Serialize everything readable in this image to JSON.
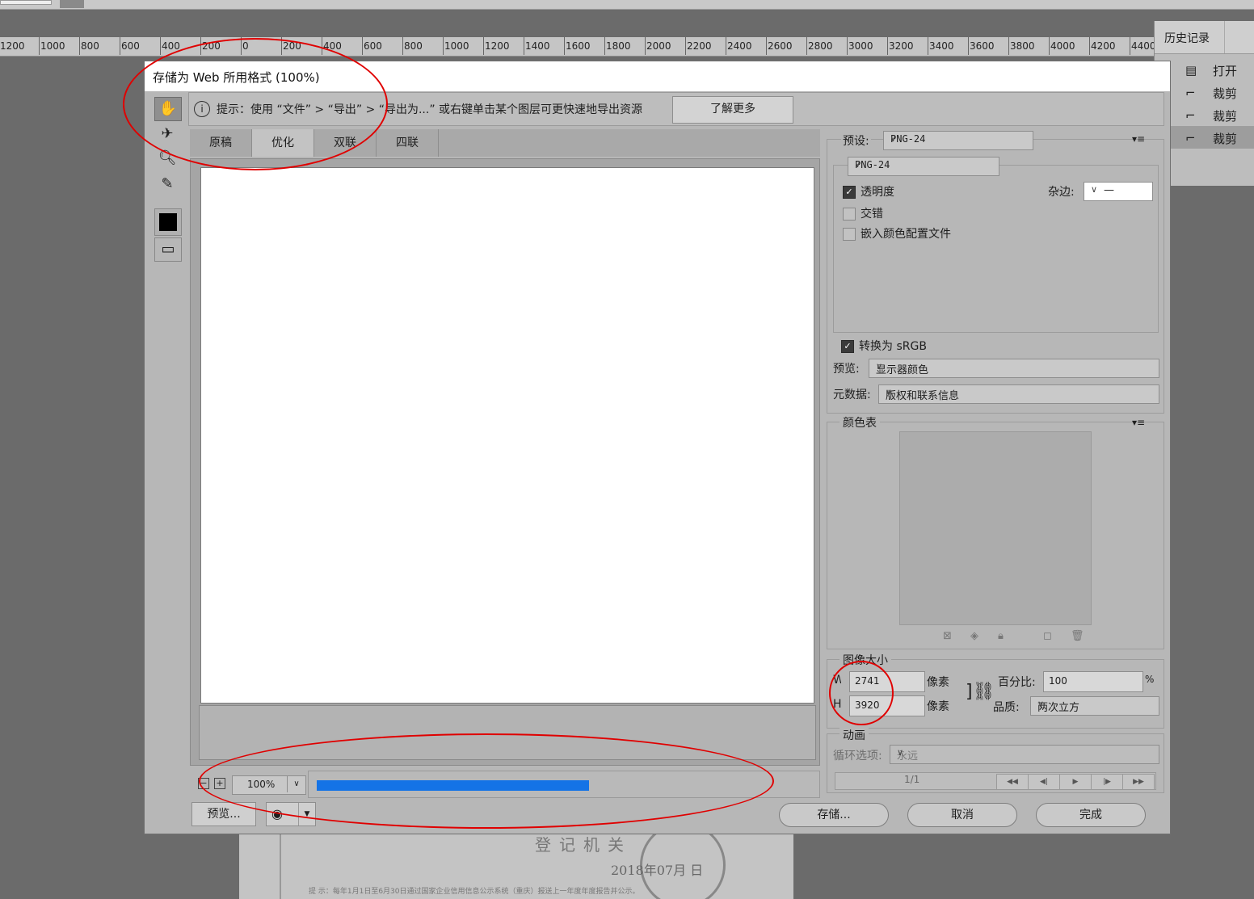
{
  "ruler": {
    "ticks": [
      "1200",
      "1000",
      "800",
      "600",
      "400",
      "200",
      "0",
      "200",
      "400",
      "600",
      "800",
      "1000",
      "1200",
      "1400",
      "1600",
      "1800",
      "2000",
      "2200",
      "2400",
      "2600",
      "2800",
      "3000",
      "3200",
      "3400",
      "3600",
      "3800",
      "4000",
      "4200",
      "4400"
    ]
  },
  "history": {
    "title": "历史记录",
    "items": [
      {
        "icon": "document-icon",
        "label": "打开"
      },
      {
        "icon": "crop-icon",
        "label": "裁剪"
      },
      {
        "icon": "crop-icon",
        "label": "裁剪"
      },
      {
        "icon": "crop-icon",
        "label": "裁剪",
        "selected": true
      }
    ]
  },
  "document": {
    "heading": "登记机关",
    "date": "2018年07月 日",
    "footnote": "提 示：每年1月1日至6月30日通过国家企业信用信息公示系统（重庆）报送上一年度年度报告并公示。"
  },
  "dialog": {
    "title": "存储为 Web 所用格式 (100%)",
    "hint": "提示：使用 “文件” > “导出” > “导出为...” 或右键单击某个图层可更快速地导出资源",
    "learn_more": "了解更多",
    "tabs": [
      "原稿",
      "优化",
      "双联",
      "四联"
    ],
    "active_tab": "优化",
    "zoom": "100%",
    "progress": 0.55,
    "preview_button": "预览...",
    "save_button": "存储...",
    "cancel_button": "取消",
    "done_button": "完成"
  },
  "settings": {
    "preset_label": "预设:",
    "preset_value": "PNG-24",
    "format_value": "PNG-24",
    "transparency_label": "透明度",
    "transparency": true,
    "matte_label": "杂边:",
    "matte_value": "—",
    "interlaced_label": "交错",
    "interlaced": false,
    "embed_profile_label": "嵌入颜色配置文件",
    "embed_profile": false,
    "convert_srgb_label": "转换为 sRGB",
    "convert_srgb": true,
    "preview_label": "预览:",
    "preview_value": "显示器颜色",
    "metadata_label": "元数据:",
    "metadata_value": "版权和联系信息"
  },
  "color_table": {
    "title": "颜色表"
  },
  "image_size": {
    "title": "图像大小",
    "w_label": "W:",
    "h_label": "H:",
    "width": "2741",
    "height": "3920",
    "unit": "像素",
    "percent_label": "百分比:",
    "percent": "100",
    "percent_unit": "%",
    "quality_label": "品质:",
    "quality_value": "两次立方"
  },
  "animation": {
    "title": "动画",
    "loop_label": "循环选项:",
    "loop_value": "永远",
    "frame": "1/1"
  },
  "colors": {
    "accent": "#1473e6",
    "annotation": "#e00000"
  }
}
